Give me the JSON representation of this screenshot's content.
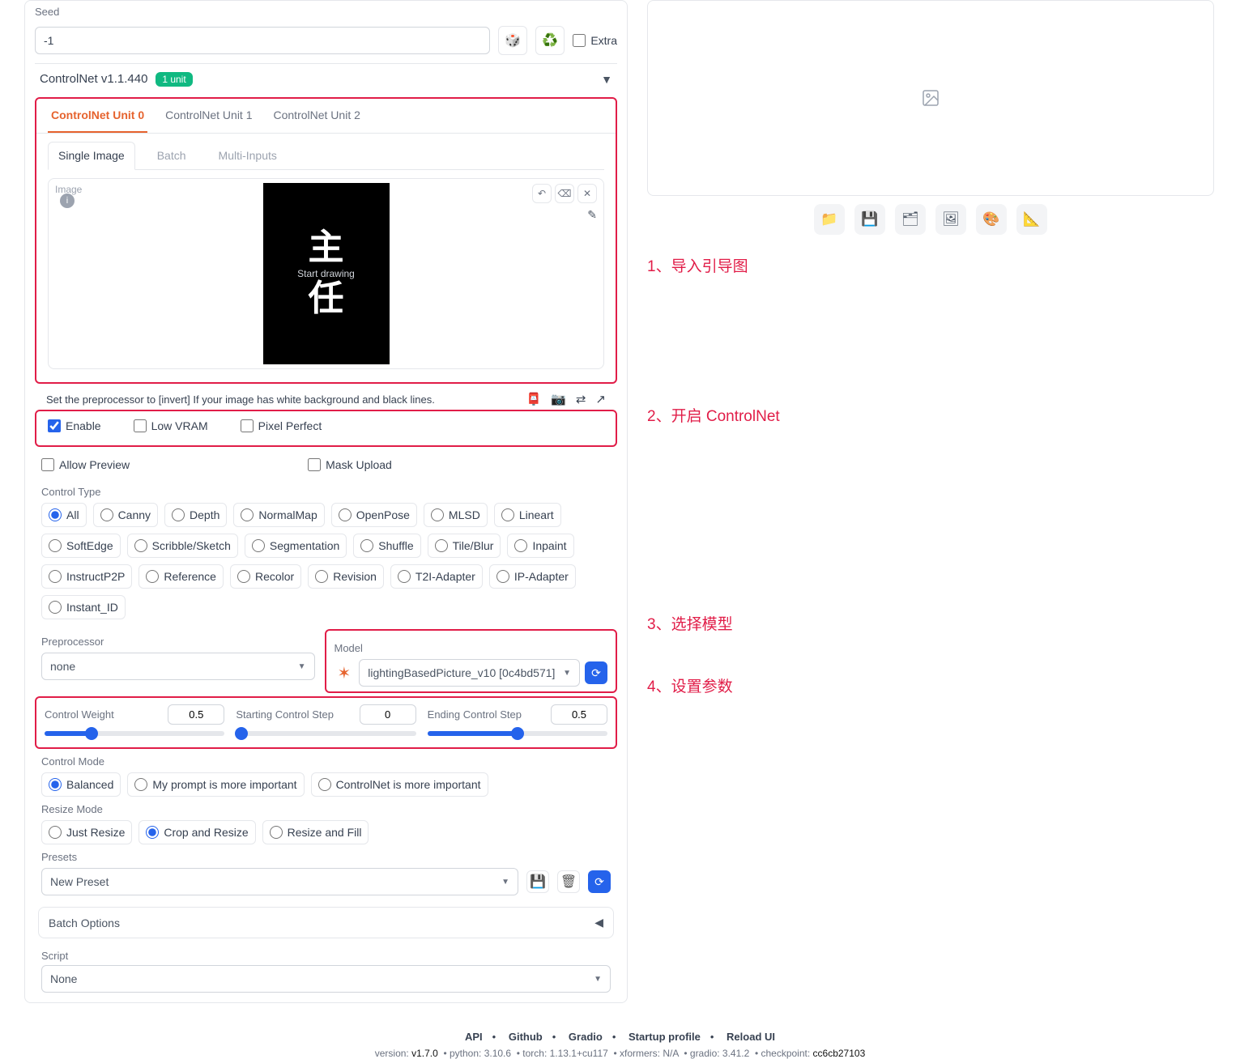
{
  "seed": {
    "label": "Seed",
    "value": "-1",
    "extra_label": "Extra"
  },
  "controlnet": {
    "title": "ControlNet v1.1.440",
    "badge": "1 unit",
    "unit_tabs": [
      "ControlNet Unit 0",
      "ControlNet Unit 1",
      "ControlNet Unit 2"
    ],
    "input_tabs": [
      "Single Image",
      "Batch",
      "Multi-Inputs"
    ],
    "image_label": "Image",
    "start_drawing": "Start drawing",
    "glyph_top": "主",
    "glyph_bottom": "任",
    "invert_hint": "Set the preprocessor to [invert] If your image has white background and black lines.",
    "enable": "Enable",
    "low_vram": "Low VRAM",
    "pixel_perfect": "Pixel Perfect",
    "allow_preview": "Allow Preview",
    "mask_upload": "Mask Upload",
    "control_type_label": "Control Type",
    "control_types": [
      "All",
      "Canny",
      "Depth",
      "NormalMap",
      "OpenPose",
      "MLSD",
      "Lineart",
      "SoftEdge",
      "Scribble/Sketch",
      "Segmentation",
      "Shuffle",
      "Tile/Blur",
      "Inpaint",
      "InstructP2P",
      "Reference",
      "Recolor",
      "Revision",
      "T2I-Adapter",
      "IP-Adapter",
      "Instant_ID"
    ],
    "preprocessor_label": "Preprocessor",
    "preprocessor_value": "none",
    "model_label": "Model",
    "model_value": "lightingBasedPicture_v10 [0c4bd571]",
    "sliders": {
      "weight_label": "Control Weight",
      "weight_value": "0.5",
      "start_label": "Starting Control Step",
      "start_value": "0",
      "end_label": "Ending Control Step",
      "end_value": "0.5"
    },
    "control_mode_label": "Control Mode",
    "control_modes": [
      "Balanced",
      "My prompt is more important",
      "ControlNet is more important"
    ],
    "resize_label": "Resize Mode",
    "resize_modes": [
      "Just Resize",
      "Crop and Resize",
      "Resize and Fill"
    ],
    "presets_label": "Presets",
    "presets_value": "New Preset",
    "batch_options": "Batch Options"
  },
  "script": {
    "label": "Script",
    "value": "None"
  },
  "annotations": {
    "a1": "1、导入引导图",
    "a2": "2、开启 ControlNet",
    "a3": "3、选择模型",
    "a4": "4、设置参数"
  },
  "footer": {
    "api": "API",
    "github": "Github",
    "gradio": "Gradio",
    "startup": "Startup profile",
    "reload": "Reload UI",
    "line_prefix": "version: ",
    "version": "v1.7.0",
    "python": "python: 3.10.6",
    "torch": "torch: 1.13.1+cu117",
    "xformers": "xformers: N/A",
    "gradio_v": "gradio: 3.41.2",
    "checkpoint_prefix": "checkpoint: ",
    "checkpoint": "cc6cb27103"
  }
}
